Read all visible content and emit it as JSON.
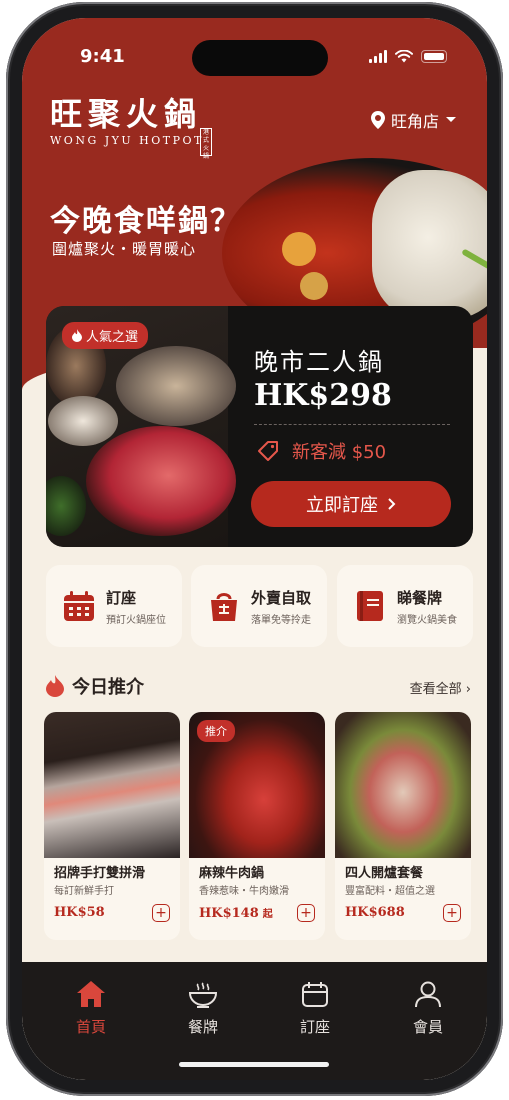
{
  "status_bar": {
    "time": "9:41"
  },
  "brand": {
    "name_cn": "旺聚火鍋",
    "name_en": "WONG JYU HOTPOT",
    "seal": "港式火鍋"
  },
  "location": {
    "label": "旺角店",
    "icon": "location-pin-icon"
  },
  "hero": {
    "headline": "今晚食咩鍋？",
    "subline": "圍爐聚火・暖胃暖心"
  },
  "promo": {
    "badge": "人氣之選",
    "title": "晚市二人鍋",
    "price": "HK$298",
    "coupon": "新客減 $50",
    "button": "立即訂座"
  },
  "quick_actions": [
    {
      "title": "訂座",
      "subtitle": "預訂火鍋座位",
      "icon": "calendar-icon"
    },
    {
      "title": "外賣自取",
      "subtitle": "落單免等拎走",
      "icon": "takeaway-bag-icon"
    },
    {
      "title": "睇餐牌",
      "subtitle": "瀏覽火鍋美食",
      "icon": "menu-book-icon"
    }
  ],
  "recommend": {
    "title": "今日推介",
    "see_all": "查看全部",
    "items": [
      {
        "name": "招牌手打雙拼滑",
        "desc": "每訂新鮮手打",
        "price": "HK$58",
        "suffix": "",
        "badge": ""
      },
      {
        "name": "麻辣牛肉鍋",
        "desc": "香辣惹味・牛肉嫩滑",
        "price": "HK$148",
        "suffix": "起",
        "badge": "推介"
      },
      {
        "name": "四人開爐套餐",
        "desc": "豐富配料・超值之選",
        "price": "HK$688",
        "suffix": "",
        "badge": ""
      }
    ]
  },
  "tabs": [
    {
      "label": "首頁",
      "icon": "home-icon",
      "active": true
    },
    {
      "label": "餐牌",
      "icon": "bowl-icon",
      "active": false
    },
    {
      "label": "訂座",
      "icon": "calendar-icon",
      "active": false
    },
    {
      "label": "會員",
      "icon": "user-icon",
      "active": false
    }
  ],
  "colors": {
    "brand_red": "#992a1f",
    "accent": "#b6291e",
    "background": "#f6efe4",
    "dark": "#141312"
  }
}
